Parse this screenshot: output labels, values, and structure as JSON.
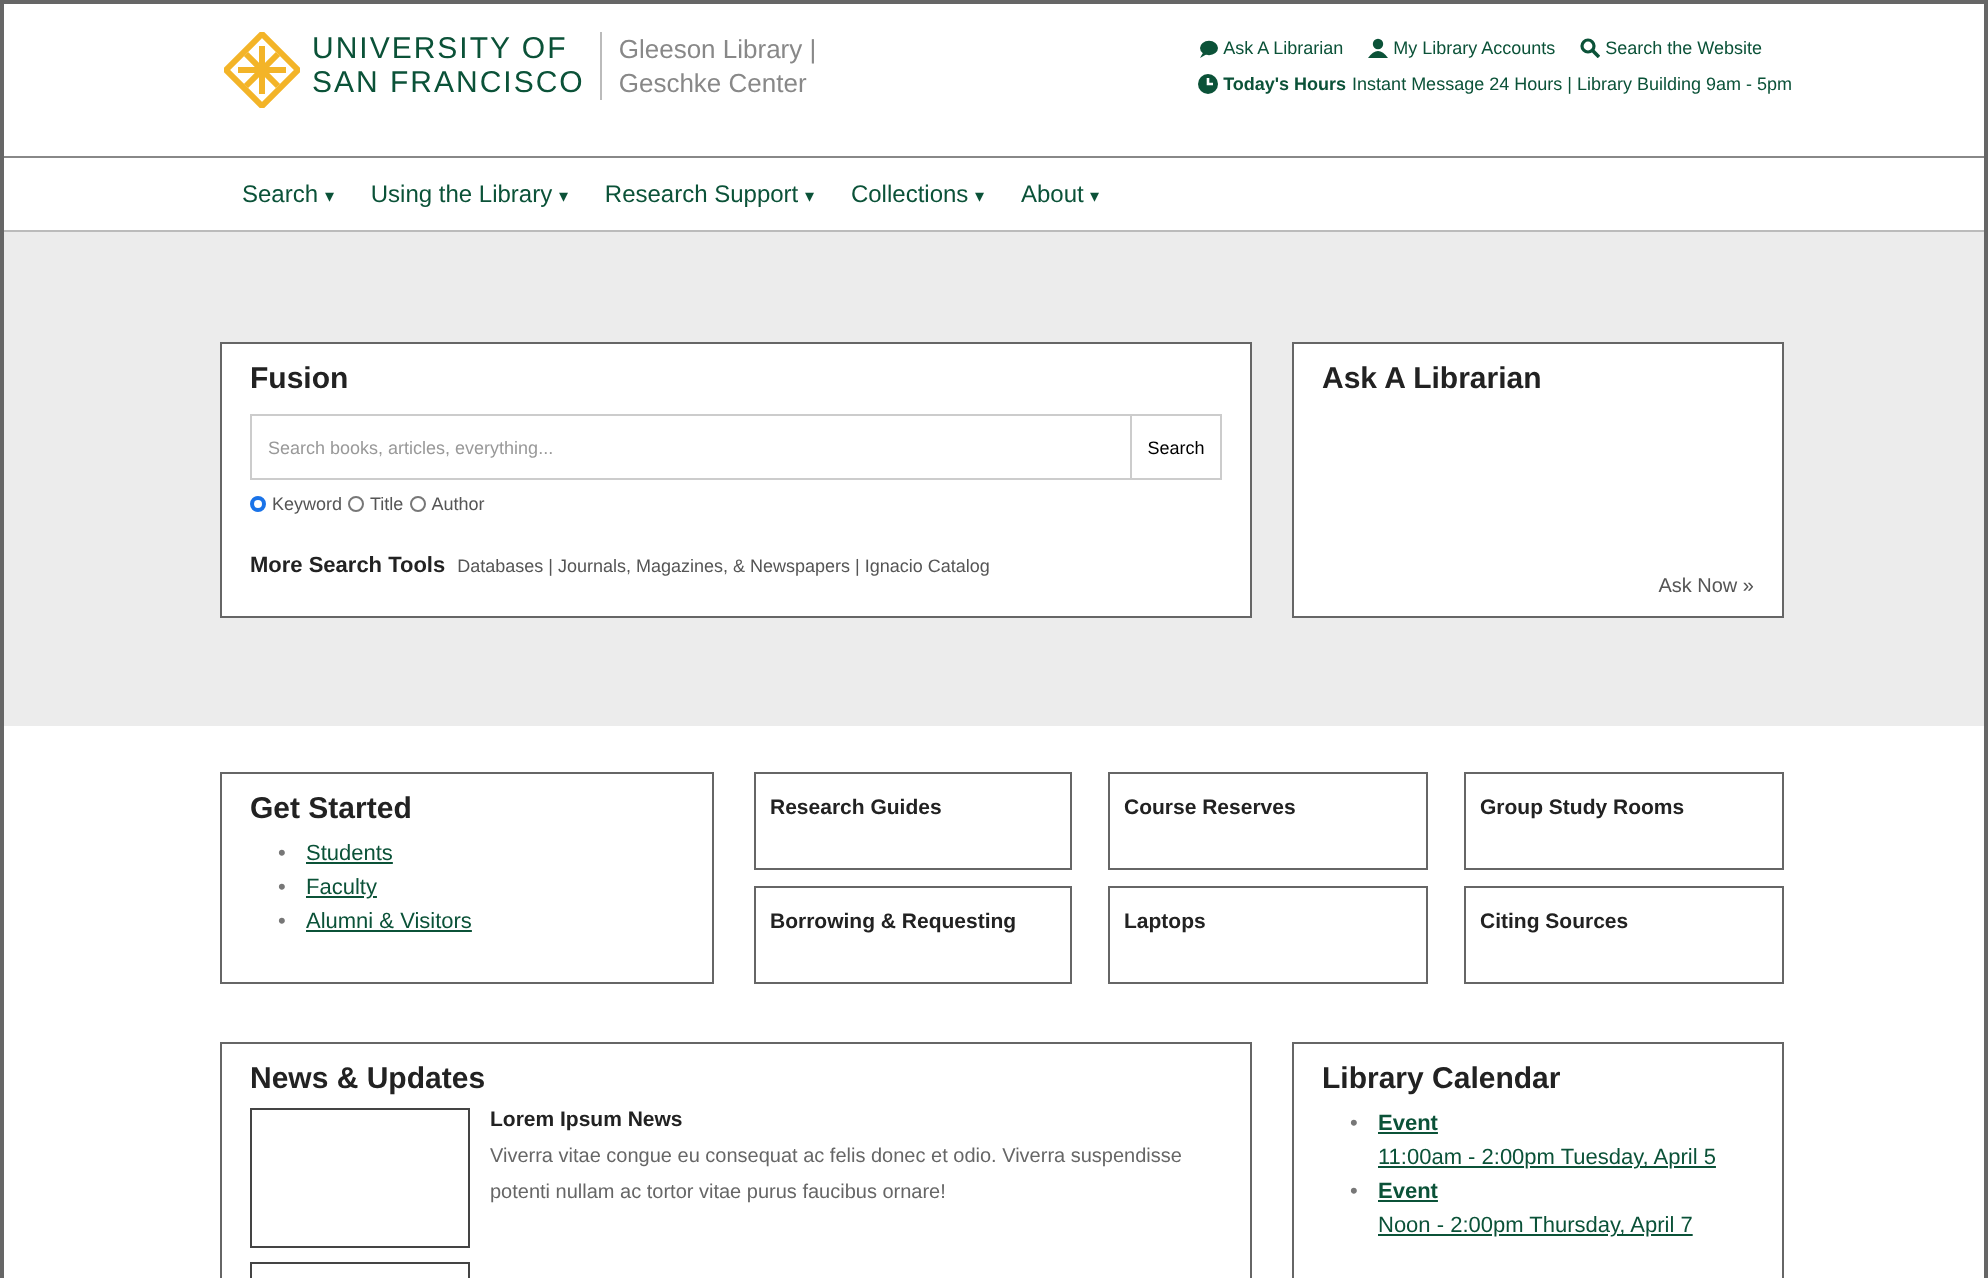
{
  "logo": {
    "line1": "UNIVERSITY OF",
    "line2": "SAN FRANCISCO",
    "sub1": "Gleeson Library |",
    "sub2": "Geschke Center"
  },
  "utility_links": [
    {
      "kind": "chat",
      "label": "Ask A Librarian"
    },
    {
      "kind": "user",
      "label": "My Library Accounts"
    },
    {
      "kind": "search",
      "label": "Search the Website"
    }
  ],
  "hours": {
    "label": "Today's Hours",
    "text": "Instant Message 24 Hours | Library Building 9am - 5pm"
  },
  "nav": [
    {
      "label": "Search",
      "caret": "▾"
    },
    {
      "label": "Using the Library",
      "caret": "▾"
    },
    {
      "label": "Research Support",
      "caret": "▾"
    },
    {
      "label": "Collections",
      "caret": "▾"
    },
    {
      "label": "About",
      "caret": "▾"
    }
  ],
  "fusion": {
    "title": "Fusion",
    "placeholder": "Search books, articles, everything...",
    "button": "Search",
    "options": [
      {
        "label": "Keyword",
        "selected": true
      },
      {
        "label": "Title",
        "selected": false
      },
      {
        "label": "Author",
        "selected": false
      }
    ],
    "tools_label": "More Search Tools",
    "tools_links": "Databases | Journals, Magazines, & Newspapers | Ignacio Catalog"
  },
  "ask": {
    "title": "Ask A Librarian",
    "link": "Ask Now »"
  },
  "get_started": {
    "title": "Get Started",
    "links": [
      {
        "bullet": "•",
        "label": "Students"
      },
      {
        "bullet": "•",
        "label": "Faculty"
      },
      {
        "bullet": "•",
        "label": "Alumni & Visitors"
      }
    ]
  },
  "tiles": [
    "Research Guides",
    "Course Reserves",
    "Group Study Rooms",
    "Borrowing & Requesting",
    "Laptops",
    "Citing Sources"
  ],
  "news": {
    "title": "News & Updates",
    "items": [
      {
        "title": "Lorem Ipsum News",
        "text": "Viverra vitae congue eu consequat ac felis donec et odio. Viverra suspendisse potenti nullam ac tortor vitae purus faucibus ornare!"
      }
    ]
  },
  "calendar": {
    "title": "Library Calendar",
    "events": [
      {
        "bullet": "•",
        "title": "Event",
        "time": "11:00am - 2:00pm Tuesday, April 5"
      },
      {
        "bullet": "•",
        "title": "Event",
        "time": "Noon - 2:00pm Thursday, April 7"
      }
    ]
  }
}
